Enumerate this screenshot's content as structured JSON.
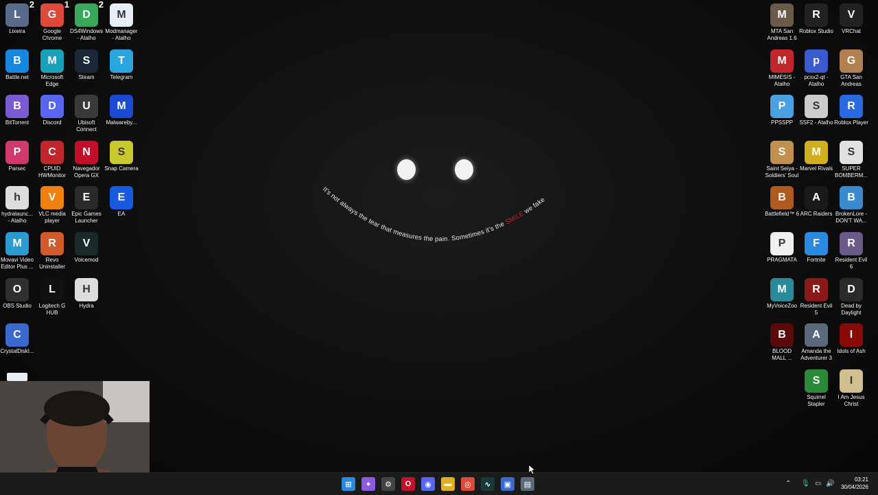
{
  "wallpaper": {
    "quote_plain_1": "It's not always the tear that measures the pain. Sometimes it's the ",
    "quote_highlight": "SMILE",
    "quote_plain_2": " we fake",
    "highlight_color": "#c0262b"
  },
  "desktop_left": [
    {
      "label": "Lixeira",
      "icon": "recycle-bin-icon",
      "color": "#5a6a8a",
      "badge": "2"
    },
    {
      "label": "Google Chrome",
      "icon": "chrome-icon",
      "color": "#dd4a3a",
      "badge": "1"
    },
    {
      "label": "DS4Windows - Atalho",
      "icon": "gamepad-icon",
      "color": "#3aa85a",
      "badge": "2"
    },
    {
      "label": "Modmanager - Atalho",
      "icon": "document-icon",
      "color": "#e8eef6",
      "badge": ""
    },
    {
      "label": "Battle.net",
      "icon": "battlenet-icon",
      "color": "#1488e0",
      "badge": ""
    },
    {
      "label": "Microsoft Edge",
      "icon": "edge-icon",
      "color": "#1aa0b8",
      "badge": ""
    },
    {
      "label": "Steam",
      "icon": "steam-icon",
      "color": "#1b2838",
      "badge": ""
    },
    {
      "label": "Telegram",
      "icon": "telegram-icon",
      "color": "#2aa5e0",
      "badge": ""
    },
    {
      "label": "BitTorrent",
      "icon": "bittorrent-icon",
      "color": "#7a5ad0",
      "badge": ""
    },
    {
      "label": "Discord",
      "icon": "discord-icon",
      "color": "#5865f2",
      "badge": ""
    },
    {
      "label": "Ubisoft Connect",
      "icon": "ubisoft-icon",
      "color": "#3a3a3a",
      "badge": ""
    },
    {
      "label": "Malwareby...",
      "icon": "malwarebytes-icon",
      "color": "#1a4ad0",
      "badge": ""
    },
    {
      "label": "Parsec",
      "icon": "parsec-icon",
      "color": "#d03a6a",
      "badge": ""
    },
    {
      "label": "CPUID HWMonitor",
      "icon": "hwmonitor-icon",
      "color": "#c0262b",
      "badge": ""
    },
    {
      "label": "Navegador Opera GX",
      "icon": "opera-icon",
      "color": "#c0102a",
      "badge": ""
    },
    {
      "label": "Snap Camera",
      "icon": "snap-camera-icon",
      "color": "#c8c830",
      "badge": ""
    },
    {
      "label": "hydralaunc... - Atalho",
      "icon": "hydra-icon",
      "color": "#dddddd",
      "badge": ""
    },
    {
      "label": "VLC media player",
      "icon": "vlc-icon",
      "color": "#f08010",
      "badge": ""
    },
    {
      "label": "Epic Games Launcher",
      "icon": "epic-icon",
      "color": "#2a2a2a",
      "badge": ""
    },
    {
      "label": "EA",
      "icon": "ea-icon",
      "color": "#1a5ae0",
      "badge": ""
    },
    {
      "label": "Movavi Video Editor Plus ...",
      "icon": "movavi-icon",
      "color": "#2a9ad0",
      "badge": ""
    },
    {
      "label": "Revo Uninstaller",
      "icon": "revo-icon",
      "color": "#d05a2a",
      "badge": ""
    },
    {
      "label": "Voicemod",
      "icon": "voicemod-icon",
      "color": "#1a2a2a",
      "badge": ""
    },
    {
      "label": "OBS Studio",
      "icon": "obs-icon",
      "color": "#303030",
      "badge": ""
    },
    {
      "label": "Logitech G HUB",
      "icon": "logitech-icon",
      "color": "#111111",
      "badge": ""
    },
    {
      "label": "Hydra",
      "icon": "hydra-app-icon",
      "color": "#dddddd",
      "badge": ""
    },
    {
      "label": "CrystalDiskI...",
      "icon": "crystaldisk-icon",
      "color": "#3a6ad0",
      "badge": ""
    }
  ],
  "desktop_right": [
    {
      "label": "MTA San Andreas 1.6",
      "icon": "mta-icon",
      "color": "#6a5a4a"
    },
    {
      "label": "Roblox Studio",
      "icon": "roblox-studio-icon",
      "color": "#222222"
    },
    {
      "label": "VRChat",
      "icon": "vrchat-icon",
      "color": "#222222"
    },
    {
      "label": "MIMESIS - Atalho",
      "icon": "mimesis-icon",
      "color": "#c0262b"
    },
    {
      "label": "pcsx2-qt - Atalho",
      "icon": "pcsx2-icon",
      "color": "#3a5ad0"
    },
    {
      "label": "GTA San Andreas",
      "icon": "gta-icon",
      "color": "#b08050"
    },
    {
      "label": "PPSSPP",
      "icon": "ppsspp-icon",
      "color": "#4aa0e0"
    },
    {
      "label": "SSF2 - Atalho",
      "icon": "ssf2-icon",
      "color": "#cccccc"
    },
    {
      "label": "Roblox Player",
      "icon": "roblox-player-icon",
      "color": "#2a6ae0"
    },
    {
      "label": "Saint Seiya - Soldiers' Soul",
      "icon": "saint-seiya-icon",
      "color": "#c09050"
    },
    {
      "label": "Marvel Rivals",
      "icon": "marvel-rivals-icon",
      "color": "#d0b020"
    },
    {
      "label": "SUPER BOMBERM...",
      "icon": "bomberman-icon",
      "color": "#e0e0e0"
    },
    {
      "label": "Battlefield™ 6",
      "icon": "battlefield-icon",
      "color": "#b05a20"
    },
    {
      "label": "ARC Raiders",
      "icon": "arc-raiders-icon",
      "color": "#1a1a1a"
    },
    {
      "label": "BrokenLore - DON'T WA...",
      "icon": "brokenlore-icon",
      "color": "#3a8ad0"
    },
    {
      "label": "PRAGMATA",
      "icon": "file-icon",
      "color": "#f0f0f0"
    },
    {
      "label": "Fortnite",
      "icon": "fortnite-icon",
      "color": "#2a8ae0"
    },
    {
      "label": "Resident Evil 6",
      "icon": "re6-icon",
      "color": "#6a5a8a"
    },
    {
      "label": "MyVoiceZoo",
      "icon": "myvoicezoo-icon",
      "color": "#2a8a9a"
    },
    {
      "label": "Resident Evil 5",
      "icon": "re5-icon",
      "color": "#8a1a1a"
    },
    {
      "label": "Dead by Daylight",
      "icon": "dbd-icon",
      "color": "#2a2a2a"
    },
    {
      "label": "BLOOD MALL ...",
      "icon": "blood-mall-icon",
      "color": "#5a0a0a"
    },
    {
      "label": "Amanda the Adventurer 3",
      "icon": "amanda-icon",
      "color": "#5a6a7a"
    },
    {
      "label": "Idols of Ash",
      "icon": "idols-icon",
      "color": "#8a0a0a"
    },
    {
      "label": "Squirrel Stapler",
      "icon": "squirrel-icon",
      "color": "#2a8a3a"
    },
    {
      "label": "I Am Jesus Christ",
      "icon": "jesus-icon",
      "color": "#d0c090"
    }
  ],
  "taskbar": {
    "apps": [
      {
        "name": "start-button",
        "glyph": "⊞",
        "color": "#2a8ae0"
      },
      {
        "name": "copilot-button",
        "glyph": "✦",
        "color": "#8a5ae0"
      },
      {
        "name": "settings-button",
        "glyph": "⚙",
        "color": "#444444"
      },
      {
        "name": "opera-gx-button",
        "glyph": "O",
        "color": "#c0102a"
      },
      {
        "name": "discord-button",
        "glyph": "◉",
        "color": "#5865f2"
      },
      {
        "name": "file-explorer-button",
        "glyph": "▬",
        "color": "#e0b020"
      },
      {
        "name": "chrome-button",
        "glyph": "◎",
        "color": "#dd4a3a"
      },
      {
        "name": "voicemod-button",
        "glyph": "∿",
        "color": "#1a3a3a"
      },
      {
        "name": "display-app-button",
        "glyph": "▣",
        "color": "#3a6ad0"
      },
      {
        "name": "installer-button",
        "glyph": "▤",
        "color": "#5a6a7a"
      }
    ],
    "time": "03:21",
    "date": "30/04/2026"
  }
}
